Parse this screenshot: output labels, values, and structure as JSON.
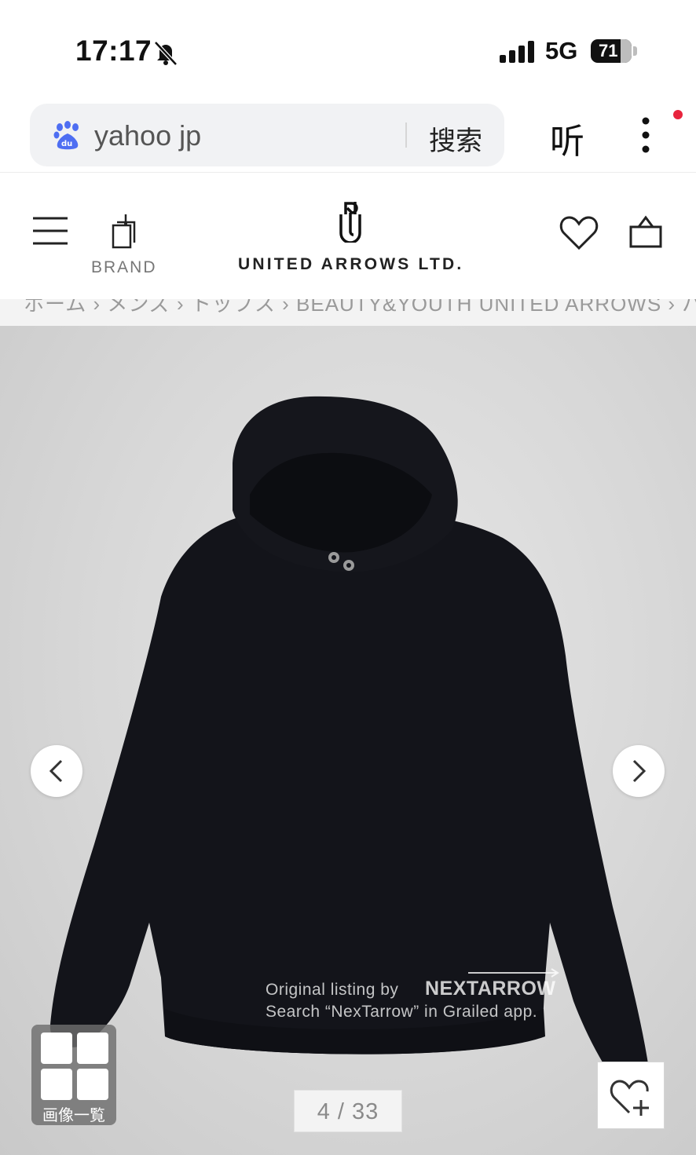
{
  "status_bar": {
    "time": "17:17",
    "network": "5G",
    "battery": "71"
  },
  "browser": {
    "search_text": "yahoo jp",
    "search_button": "搜索",
    "listen_button": "听"
  },
  "site_header": {
    "brand_label": "BRAND",
    "logo_text": "UNITED ARROWS LTD."
  },
  "breadcrumb": {
    "text": "ホーム › メンズ › トップス › BEAUTY&YOUTH UNITED ARROWS › パーカー・フーディー"
  },
  "product": {
    "watermark_line1": "Original listing by",
    "watermark_brand": "NEXTARROW",
    "watermark_line2": "Search “NexTarrow” in Grailed app.",
    "gallery_label": "画像一覧",
    "page_counter": "4 / 33"
  },
  "colors": {
    "accent_dot": "#e8243d",
    "hoodie": "#13141a",
    "backdrop": "#d7d7d7"
  }
}
